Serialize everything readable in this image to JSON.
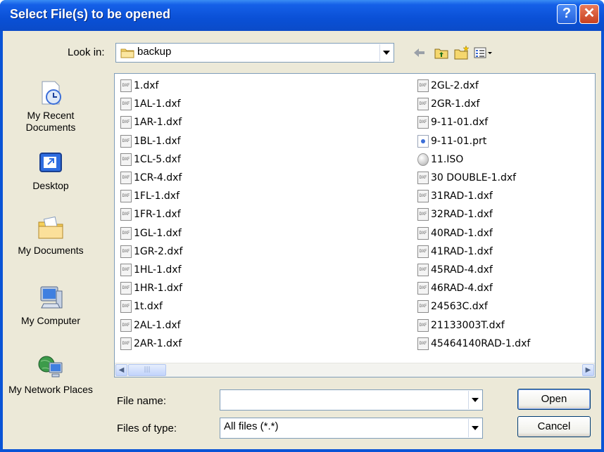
{
  "window": {
    "title": "Select File(s) to be opened",
    "help_label": "?",
    "close_label": "✕"
  },
  "lookin": {
    "label": "Look in:",
    "value": "backup"
  },
  "toolbar": {
    "back_icon": "back-arrow-icon",
    "up_icon": "up-folder-icon",
    "new_folder_icon": "new-folder-icon",
    "views_icon": "views-menu-icon"
  },
  "places": [
    {
      "label": "My Recent Documents",
      "icon": "recent-documents-icon"
    },
    {
      "label": "Desktop",
      "icon": "desktop-icon"
    },
    {
      "label": "My Documents",
      "icon": "my-documents-icon"
    },
    {
      "label": "My Computer",
      "icon": "my-computer-icon"
    },
    {
      "label": "My Network Places",
      "icon": "network-places-icon"
    }
  ],
  "files_col1": [
    {
      "name": "1.dxf",
      "type": "dxf"
    },
    {
      "name": "1AL-1.dxf",
      "type": "dxf"
    },
    {
      "name": "1AR-1.dxf",
      "type": "dxf"
    },
    {
      "name": "1BL-1.dxf",
      "type": "dxf"
    },
    {
      "name": "1CL-5.dxf",
      "type": "dxf"
    },
    {
      "name": "1CR-4.dxf",
      "type": "dxf"
    },
    {
      "name": "1FL-1.dxf",
      "type": "dxf"
    },
    {
      "name": "1FR-1.dxf",
      "type": "dxf"
    },
    {
      "name": "1GL-1.dxf",
      "type": "dxf"
    },
    {
      "name": "1GR-2.dxf",
      "type": "dxf"
    },
    {
      "name": "1HL-1.dxf",
      "type": "dxf"
    },
    {
      "name": "1HR-1.dxf",
      "type": "dxf"
    },
    {
      "name": "1t.dxf",
      "type": "dxf"
    },
    {
      "name": "2AL-1.dxf",
      "type": "dxf"
    },
    {
      "name": "2AR-1.dxf",
      "type": "dxf"
    }
  ],
  "files_col2": [
    {
      "name": "2GL-2.dxf",
      "type": "dxf"
    },
    {
      "name": "2GR-1.dxf",
      "type": "dxf"
    },
    {
      "name": "9-11-01.dxf",
      "type": "dxf"
    },
    {
      "name": "9-11-01.prt",
      "type": "prt"
    },
    {
      "name": "11.ISO",
      "type": "iso"
    },
    {
      "name": "30 DOUBLE-1.dxf",
      "type": "dxf"
    },
    {
      "name": "31RAD-1.dxf",
      "type": "dxf"
    },
    {
      "name": "32RAD-1.dxf",
      "type": "dxf"
    },
    {
      "name": "40RAD-1.dxf",
      "type": "dxf"
    },
    {
      "name": "41RAD-1.dxf",
      "type": "dxf"
    },
    {
      "name": "45RAD-4.dxf",
      "type": "dxf"
    },
    {
      "name": "46RAD-4.dxf",
      "type": "dxf"
    },
    {
      "name": "24563C.dxf",
      "type": "dxf"
    },
    {
      "name": "21133003T.dxf",
      "type": "dxf"
    },
    {
      "name": "45464140RAD-1.dxf",
      "type": "dxf"
    }
  ],
  "dxf_icon_text": "DXF",
  "scrollbar": {
    "left_arrow": "◀",
    "right_arrow": "▶",
    "thumb_grip": "|||"
  },
  "filename": {
    "label": "File name:",
    "value": ""
  },
  "filetype": {
    "label": "Files of type:",
    "value": "All files (*.*)"
  },
  "buttons": {
    "open": "Open",
    "cancel": "Cancel"
  }
}
